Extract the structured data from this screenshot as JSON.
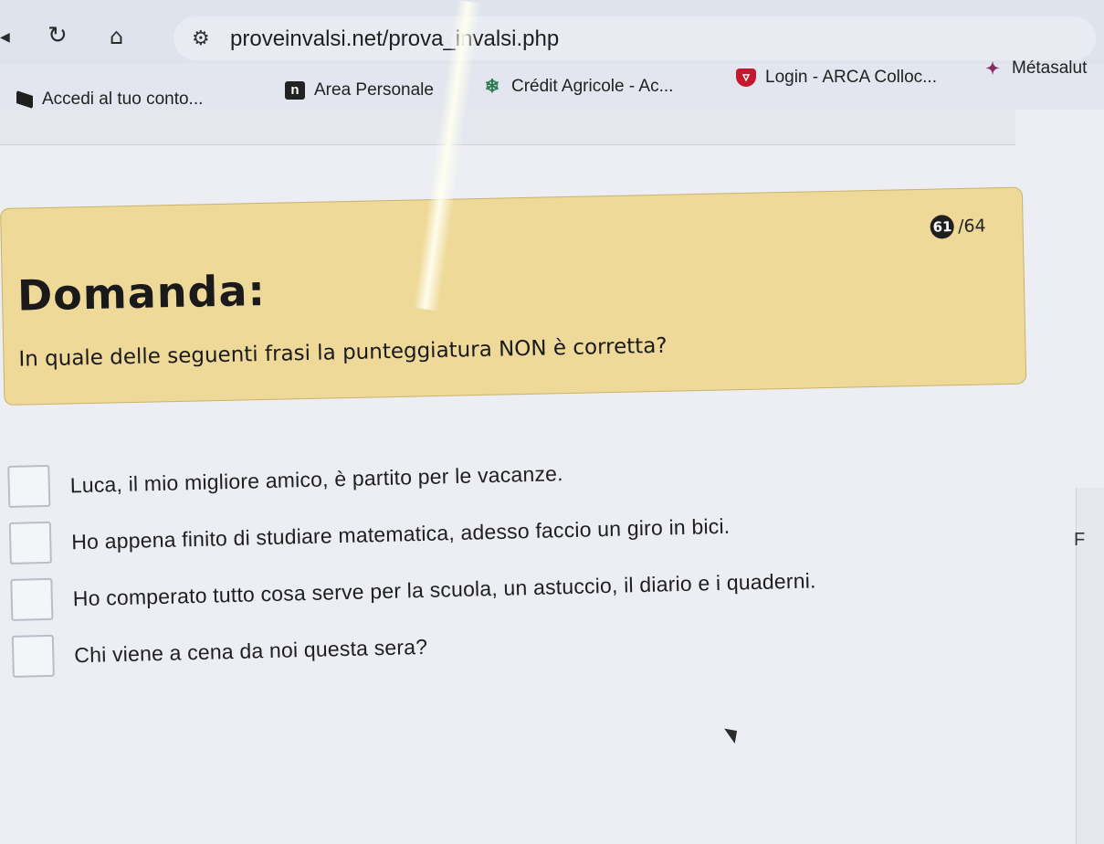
{
  "browser": {
    "url": "proveinvalsi.net/prova_invalsi.php",
    "bookmarks": [
      {
        "label": "Accedi al tuo conto...",
        "icon": "bookmark-flag-icon"
      },
      {
        "label": "Area Personale",
        "icon": "n-logo-icon"
      },
      {
        "label": "Crédit Agricole - Ac...",
        "icon": "credit-agricole-logo-icon"
      },
      {
        "label": "Login - ARCA Colloc...",
        "icon": "arca-logo-icon"
      },
      {
        "label": "Métasalut",
        "icon": "metasalute-logo-icon"
      }
    ]
  },
  "question": {
    "current": "61",
    "total": "/64",
    "heading": "Domanda:",
    "text": "In quale delle seguenti frasi la punteggiatura NON è corretta?"
  },
  "answers": [
    {
      "text": "Luca, il mio migliore amico, è partito per le vacanze.",
      "checked": false
    },
    {
      "text": "Ho appena finito di studiare matematica, adesso faccio un giro in bici.",
      "checked": false
    },
    {
      "text": "Ho comperato tutto cosa serve per la scuola, un astuccio, il diario e i quaderni.",
      "checked": false
    },
    {
      "text": "Chi viene a cena da noi questa sera?",
      "checked": false
    }
  ],
  "side_letter": "F",
  "colors": {
    "question_box": "#eed999",
    "page_background": "#eceef3",
    "chrome": "#dfe3ec"
  }
}
